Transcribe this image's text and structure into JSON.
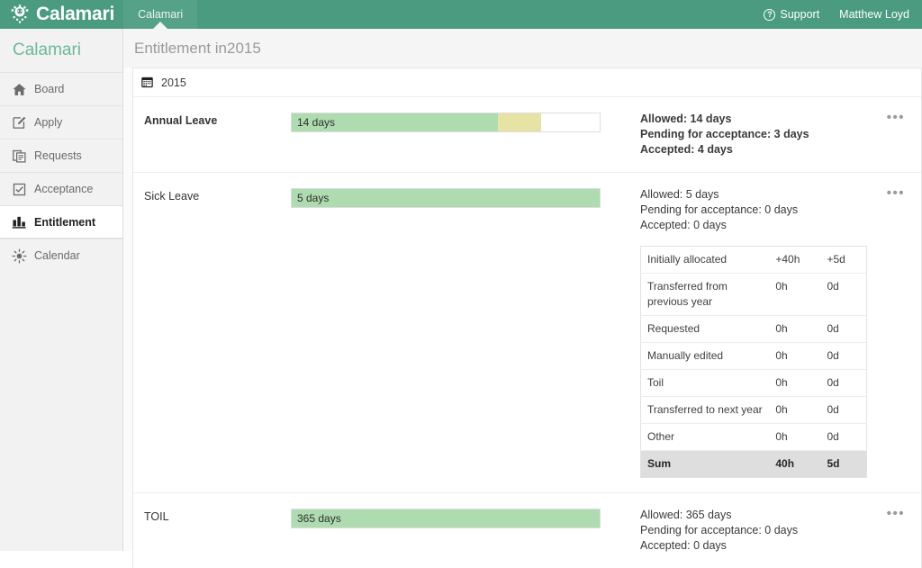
{
  "topbar": {
    "brand": "Calamari",
    "brand_icon": "ornate-squid-logo-icon",
    "tab_label": "Calamari",
    "support_label": "Support",
    "support_icon": "question-circle-icon",
    "user_name": "Matthew Loyd",
    "accent_color": "#4a9b80"
  },
  "sidebar": {
    "title": "Calamari",
    "items": [
      {
        "label": "Board",
        "icon": "home-icon",
        "active": false
      },
      {
        "label": "Apply",
        "icon": "pencil-square-icon",
        "active": false
      },
      {
        "label": "Requests",
        "icon": "documents-icon",
        "active": false
      },
      {
        "label": "Acceptance",
        "icon": "clipboard-check-icon",
        "active": false
      },
      {
        "label": "Entitlement",
        "icon": "bar-chart-icon",
        "active": true
      },
      {
        "label": "Calendar",
        "icon": "sun-icon",
        "active": false
      }
    ]
  },
  "main": {
    "page_title": "Entitlement in2015",
    "year_label": "2015",
    "year_icon": "calendar-icon",
    "menu_dots": "•••",
    "colors": {
      "accepted": "#aedcb0",
      "pending": "#e7e3a5",
      "remaining": "#ffffff"
    },
    "leaves": [
      {
        "name": "Annual Leave",
        "bold": true,
        "bar_label": "14 days",
        "accepted_pct": 67,
        "pending_pct": 14,
        "allowed": "Allowed: 14 days",
        "pending_text": "Pending for acceptance: 3 days",
        "accepted_text": "Accepted: 4 days"
      },
      {
        "name": "Sick Leave",
        "bold": false,
        "bar_label": "5 days",
        "accepted_pct": 100,
        "pending_pct": 0,
        "allowed": "Allowed: 5 days",
        "pending_text": "Pending for acceptance: 0 days",
        "accepted_text": "Accepted: 0 days"
      },
      {
        "name": "TOIL",
        "bold": false,
        "bar_label": "365 days",
        "accepted_pct": 100,
        "pending_pct": 0,
        "allowed": "Allowed: 365 days",
        "pending_text": "Pending for acceptance: 0 days",
        "accepted_text": "Accepted: 0 days"
      }
    ],
    "detail_table": {
      "rows": [
        {
          "name": "Initially allocated",
          "hours": "+40h",
          "days": "+5d",
          "sum": false
        },
        {
          "name": "Transferred from previous year",
          "hours": "0h",
          "days": "0d",
          "sum": false
        },
        {
          "name": "Requested",
          "hours": "0h",
          "days": "0d",
          "sum": false
        },
        {
          "name": "Manually edited",
          "hours": "0h",
          "days": "0d",
          "sum": false
        },
        {
          "name": "Toil",
          "hours": "0h",
          "days": "0d",
          "sum": false
        },
        {
          "name": "Transferred to next year",
          "hours": "0h",
          "days": "0d",
          "sum": false
        },
        {
          "name": "Other",
          "hours": "0h",
          "days": "0d",
          "sum": false
        },
        {
          "name": "Sum",
          "hours": "40h",
          "days": "5d",
          "sum": true
        }
      ]
    }
  }
}
